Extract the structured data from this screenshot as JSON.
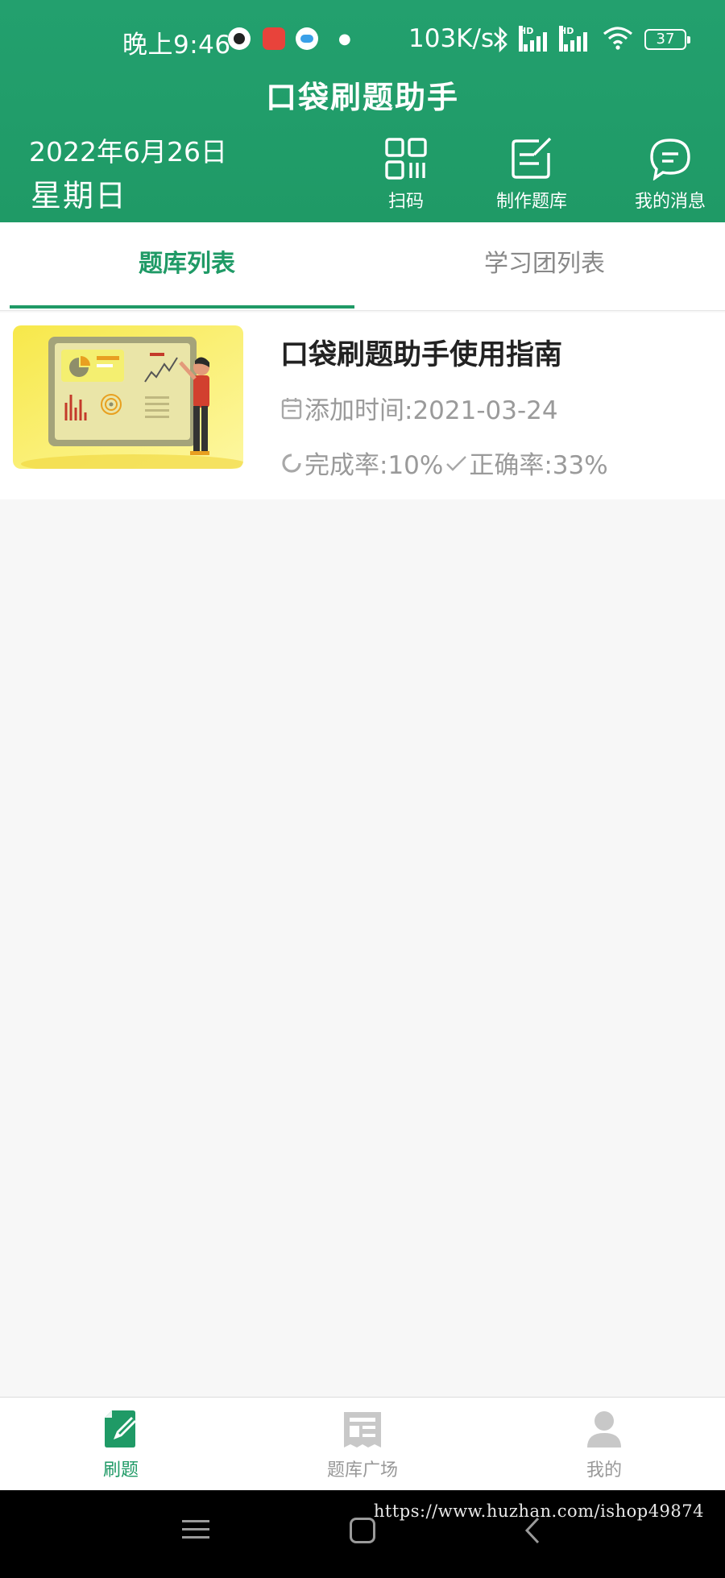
{
  "status_bar": {
    "time": "晚上9:46",
    "net_speed": "103K/s",
    "signal_label": "HD",
    "battery": "37"
  },
  "header": {
    "title": "口袋刷题助手",
    "date": "2022年6月26日",
    "weekday": "星期日",
    "actions": [
      {
        "label": "扫码",
        "icon": "qr-scan-icon"
      },
      {
        "label": "制作题库",
        "icon": "edit-note-icon"
      },
      {
        "label": "我的消息",
        "icon": "chat-bubble-icon"
      }
    ],
    "accent_color": "#1f9a66"
  },
  "tabs": [
    {
      "label": "题库列表",
      "active": true
    },
    {
      "label": "学习团列表",
      "active": false
    }
  ],
  "question_bank": {
    "title": "口袋刷题助手使用指南",
    "added_label": "添加时间:2021-03-24",
    "completion_label": "完成率:10%",
    "accuracy_label": "正确率:33%",
    "completion_rate": 0.1,
    "accuracy_rate": 0.33
  },
  "bottom_nav": [
    {
      "label": "刷题",
      "icon": "practice-icon",
      "active": true
    },
    {
      "label": "题库广场",
      "icon": "bank-square-icon",
      "active": false
    },
    {
      "label": "我的",
      "icon": "profile-icon",
      "active": false
    }
  ],
  "watermark": "https://www.huzhan.com/ishop49874"
}
